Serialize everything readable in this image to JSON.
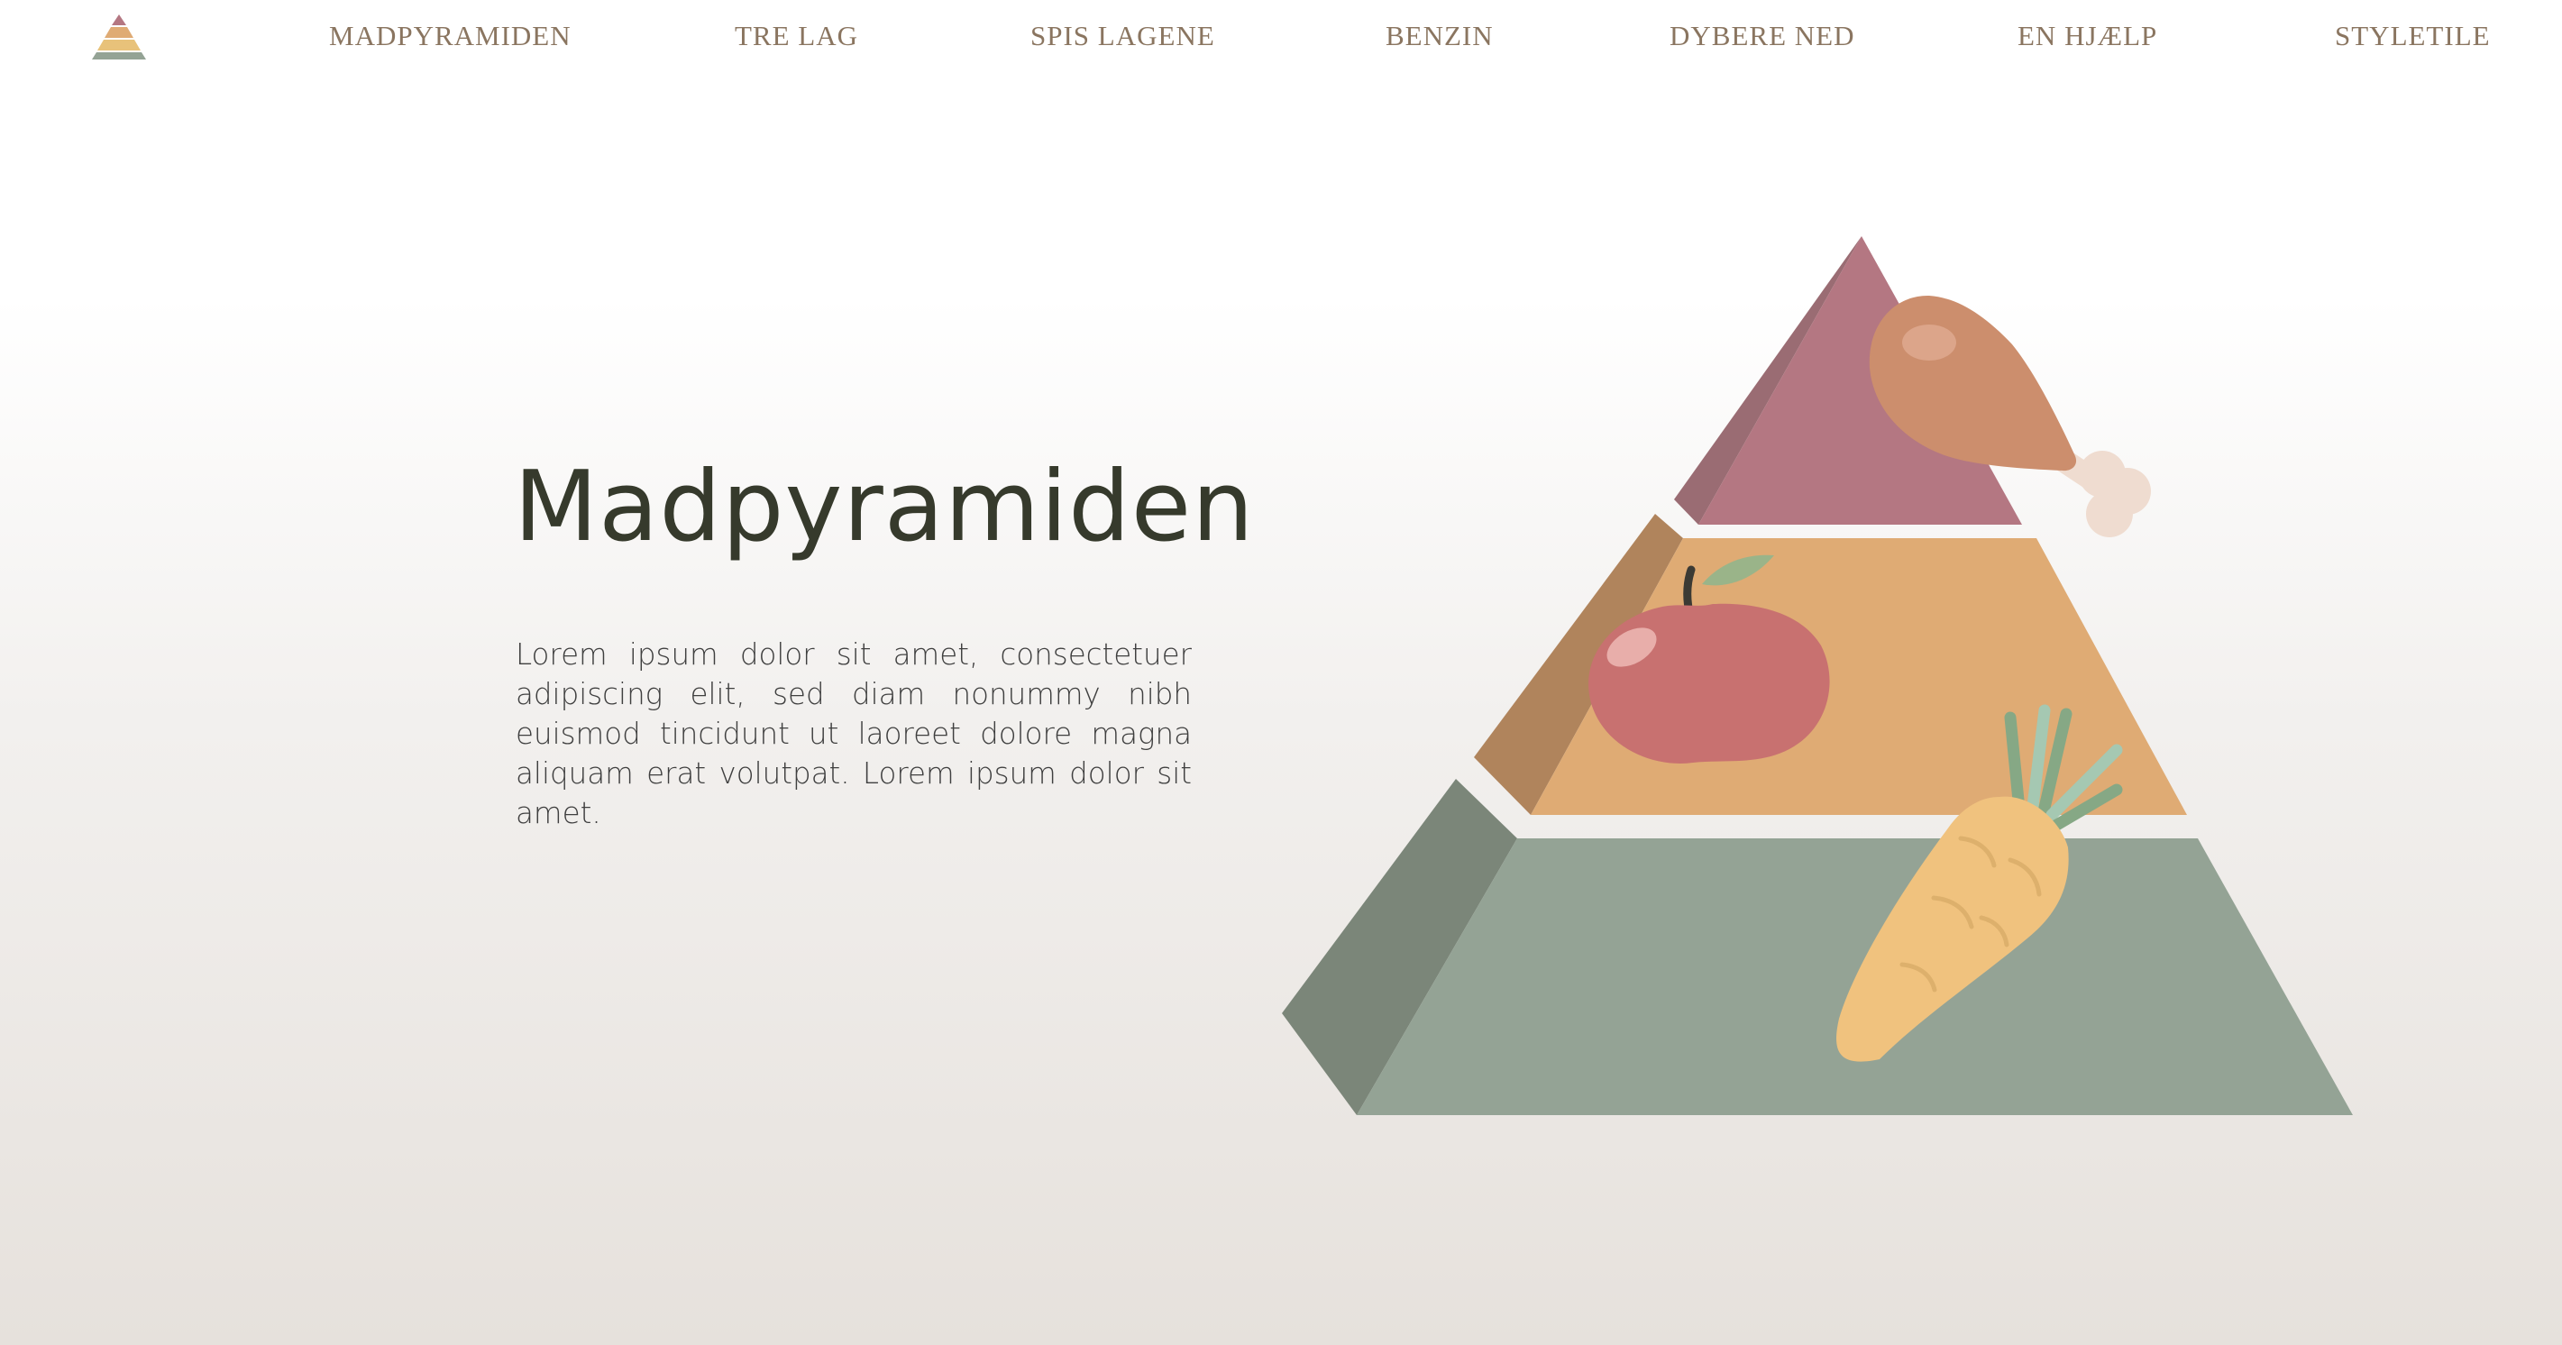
{
  "nav": {
    "logo_icon": "pyramid-logo-icon",
    "items": [
      {
        "label": "MADPYRAMIDEN"
      },
      {
        "label": "TRE LAG"
      },
      {
        "label": "SPIS LAGENE"
      },
      {
        "label": "BENZIN"
      },
      {
        "label": "DYBERE NED"
      },
      {
        "label": "EN HJÆLP"
      },
      {
        "label": "STYLETILE"
      }
    ]
  },
  "hero": {
    "title": "Madpyramiden",
    "body": "Lorem ipsum dolor sit amet, consectetuer adipiscing elit, sed diam nonummy nibh euismod tincidunt ut laoreet dolore magna aliquam erat volutpat. Lorem ipsum dolor sit amet."
  },
  "illustration": {
    "icons": [
      "food-pyramid-icon",
      "chicken-leg-icon",
      "apple-icon",
      "carrot-icon"
    ],
    "colors": {
      "top_layer": "#b47782",
      "middle_layer": "#dfab74",
      "bottom_layer": "#94a395",
      "nav_text": "#8a7560",
      "title_text": "#363a2c"
    }
  }
}
